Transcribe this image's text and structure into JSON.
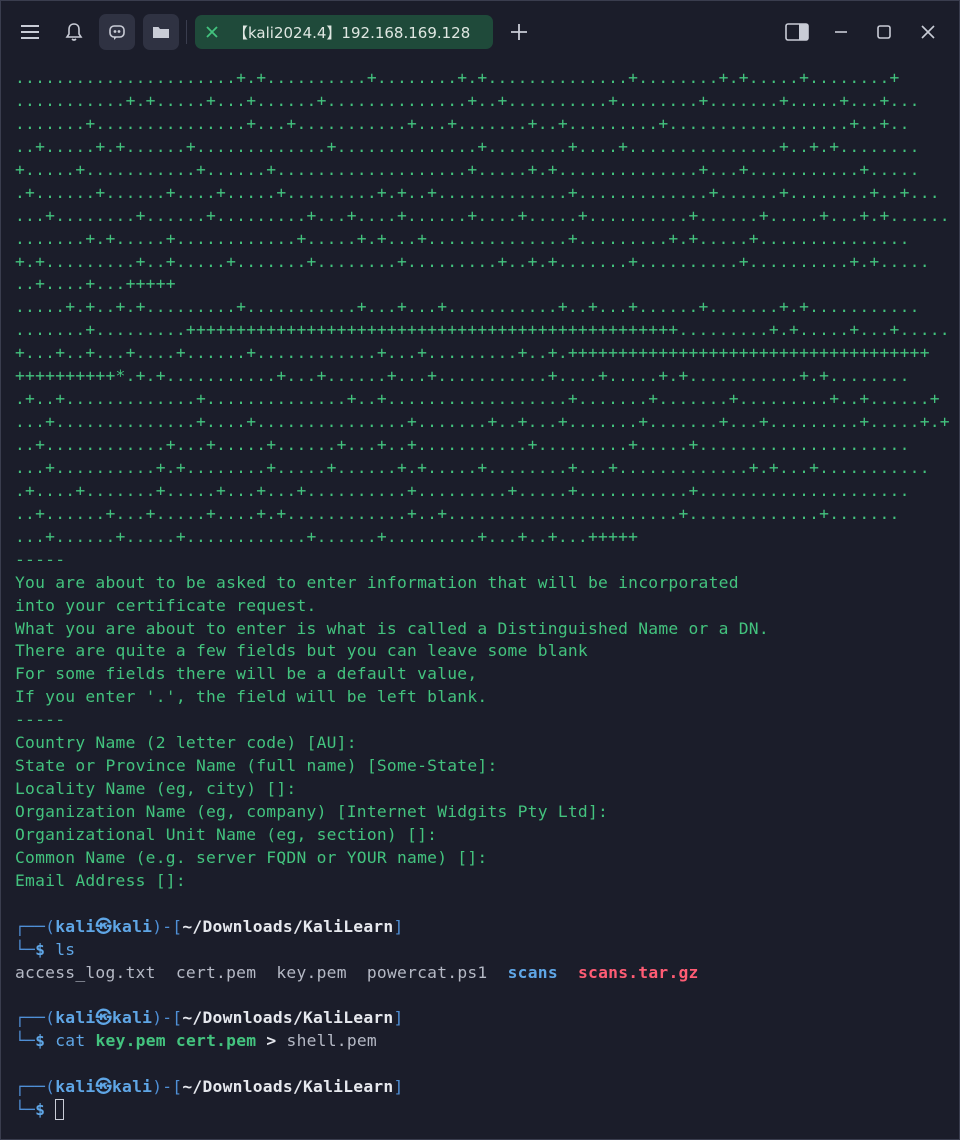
{
  "titlebar": {
    "tab_title": "【kali2024.4】192.168.169.128"
  },
  "icons": {
    "menu": "hamburger-icon",
    "bell": "bell-icon",
    "ai": "assistant-icon",
    "folder": "folder-icon",
    "tab_close": "close-icon",
    "new_tab": "plus-icon",
    "split": "split-view-icon",
    "minimize": "minimize-icon",
    "maximize": "maximize-icon",
    "close": "close-icon"
  },
  "colors": {
    "background": "#1b1d2a",
    "text_green": "#43c37e",
    "prompt_blue": "#5fa6e6",
    "archive_red": "#ff5c74",
    "tab_bg": "#1f4a3a"
  },
  "keygen_output": [
    "......................+.+..........+........+.+..............+........+.+.....+........+",
    "...........+.+.....+...+......+..............+..+..........+........+.......+.....+...+...",
    ".......+...............+...+...........+...+.......+..+.........+..................+..+..",
    "..+.....+.+......+.............+..............+........+....+...............+..+.+........",
    "+.....+...........+......+...................+.....+.+..............+...+...........+.....",
    ".+......+......+....+.....+.........+.+..+.............+.............+......+........+..+...",
    "...+........+......+.........+...+....+......+....+.....+..........+......+.....+...+.+......",
    ".......+.+.....+............+.....+.+...+..............+.........+.+.....+...............",
    "+.+.........+..+.....+.......+........+.........+..+.+.......+..........+..........+.+.....",
    "..+....+...+++++",
    ".....+.+..+.+.........+...........+...+...+...........+..+...+......+.......+.+...........",
    ".......+.........+++++++++++++++++++++++++++++++++++++++++++++++++.........+.+.....+...+.....",
    "+...+..+...+....+......+............+...+.........+..+.++++++++++++++++++++++++++++++++++++",
    "++++++++++*.+.+...........+...+......+...+...........+....+.....+.+...........+.+........",
    ".+..+.............+..............+..+..................+.......+.......+.........+..+......+",
    "...+..............+....+...............+.......+..+...+.......+.......+...+.........+.....+.+",
    "..+............+...+.....+......+...+..+...........+.........+.....+.....................",
    "...+..........+.+........+.....+......+.+.....+........+...+.............+.+...+...........",
    ".+....+.......+.....+...+...+..........+.........+.....+...........+.....................",
    "..+......+...+.....+....+.+............+..+.......................+.............+.......",
    "...+......+.....+............+......+.........+...+..+...+++++"
  ],
  "separator_1": "-----",
  "info_text": [
    "You are about to be asked to enter information that will be incorporated",
    "into your certificate request.",
    "What you are about to enter is what is called a Distinguished Name or a DN.",
    "There are quite a few fields but you can leave some blank",
    "For some fields there will be a default value,",
    "If you enter '.', the field will be left blank."
  ],
  "separator_2": "-----",
  "fields": [
    "Country Name (2 letter code) [AU]:",
    "State or Province Name (full name) [Some-State]:",
    "Locality Name (eg, city) []:",
    "Organization Name (eg, company) [Internet Widgits Pty Ltd]:",
    "Organizational Unit Name (eg, section) []:",
    "Common Name (e.g. server FQDN or YOUR name) []:",
    "Email Address []:"
  ],
  "prompt": {
    "user": "kali",
    "at": "㉿",
    "host": "kali",
    "path": "~/Downloads/KaliLearn",
    "symbol": "$",
    "corner_top": "┌──(",
    "mid": ")-[",
    "end": "]",
    "corner_bottom": "└─"
  },
  "commands": [
    {
      "cmd": "ls",
      "args": ""
    },
    {
      "cmd": "cat",
      "args": ""
    }
  ],
  "ls_output": {
    "plain": [
      "access_log.txt",
      "cert.pem",
      "key.pem",
      "powercat.ps1"
    ],
    "dir": "scans",
    "archive": "scans.tar.gz"
  },
  "cat_command": {
    "cmd": "cat",
    "file1": "key.pem",
    "file2": "cert.pem",
    "redirect": ">",
    "target": "shell.pem"
  }
}
